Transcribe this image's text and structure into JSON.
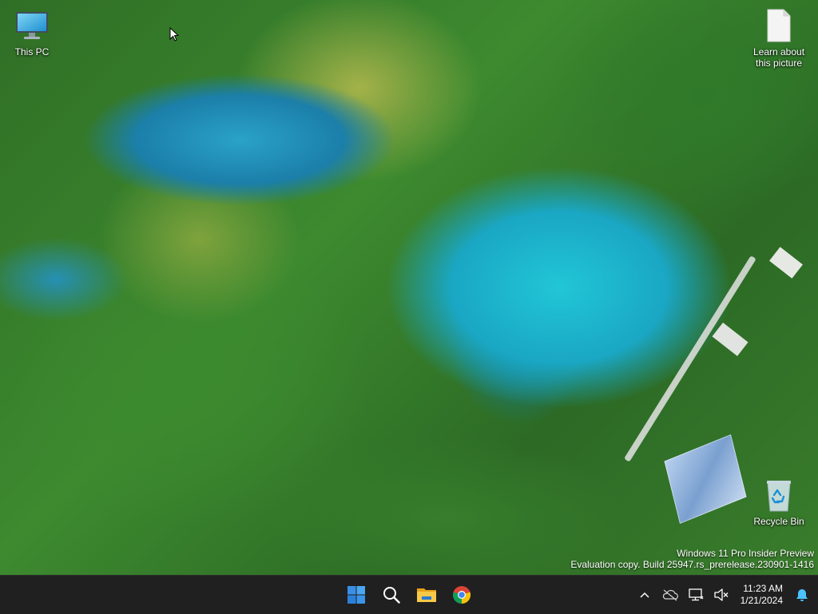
{
  "desktop": {
    "icons": {
      "this_pc": "This PC",
      "learn_about": "Learn about this picture",
      "recycle_bin": "Recycle Bin"
    },
    "watermark": {
      "line1": "Windows 11 Pro Insider Preview",
      "line2": "Evaluation copy. Build 25947.rs_prerelease.230901-1416"
    }
  },
  "taskbar": {
    "pinned": [
      "windows-start-icon",
      "search-icon",
      "file-explorer-icon",
      "chrome-icon"
    ],
    "tray": {
      "icons": [
        "chevron-up-icon",
        "onedrive-icon",
        "network-icon",
        "volume-muted-icon",
        "notification-bell-icon"
      ],
      "time": "11:23 AM",
      "date": "1/21/2024"
    },
    "colors": {
      "background": "#202020",
      "start_blue": "#3a8ee6",
      "notification_blue": "#4cc2ff"
    }
  }
}
